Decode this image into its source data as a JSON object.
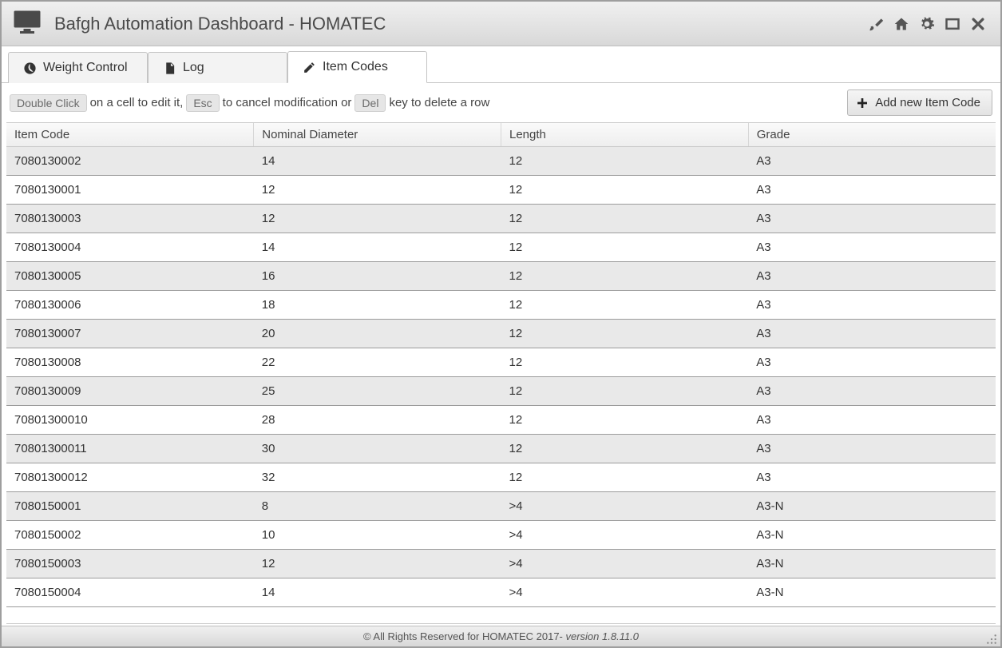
{
  "header": {
    "title": "Bafgh Automation Dashboard - HOMATEC"
  },
  "tabs": [
    {
      "label": "Weight Control",
      "active": false
    },
    {
      "label": "Log",
      "active": false
    },
    {
      "label": "Item Codes",
      "active": true
    }
  ],
  "hint": {
    "kbd_doubleclick": "Double Click",
    "text_oncell": "on a cell to edit it,",
    "kbd_esc": "Esc",
    "text_cancel": "to cancel modification or",
    "kbd_del": "Del",
    "text_delete": "key to delete a row"
  },
  "actions": {
    "add_label": "Add new Item Code"
  },
  "table": {
    "columns": [
      "Item Code",
      "Nominal Diameter",
      "Length",
      "Grade"
    ],
    "rows": [
      {
        "item_code": "7080130002",
        "nominal_diameter": "14",
        "length": "12",
        "grade": "A3"
      },
      {
        "item_code": "7080130001",
        "nominal_diameter": "12",
        "length": "12",
        "grade": "A3"
      },
      {
        "item_code": "7080130003",
        "nominal_diameter": "12",
        "length": "12",
        "grade": "A3"
      },
      {
        "item_code": "7080130004",
        "nominal_diameter": "14",
        "length": "12",
        "grade": "A3"
      },
      {
        "item_code": "7080130005",
        "nominal_diameter": "16",
        "length": "12",
        "grade": "A3"
      },
      {
        "item_code": "7080130006",
        "nominal_diameter": "18",
        "length": "12",
        "grade": "A3"
      },
      {
        "item_code": "7080130007",
        "nominal_diameter": "20",
        "length": "12",
        "grade": "A3"
      },
      {
        "item_code": "7080130008",
        "nominal_diameter": "22",
        "length": "12",
        "grade": "A3"
      },
      {
        "item_code": "7080130009",
        "nominal_diameter": "25",
        "length": "12",
        "grade": "A3"
      },
      {
        "item_code": "70801300010",
        "nominal_diameter": "28",
        "length": "12",
        "grade": "A3"
      },
      {
        "item_code": "70801300011",
        "nominal_diameter": "30",
        "length": "12",
        "grade": "A3"
      },
      {
        "item_code": "70801300012",
        "nominal_diameter": "32",
        "length": "12",
        "grade": "A3"
      },
      {
        "item_code": "7080150001",
        "nominal_diameter": "8",
        "length": ">4",
        "grade": "A3-N"
      },
      {
        "item_code": "7080150002",
        "nominal_diameter": "10",
        "length": ">4",
        "grade": "A3-N"
      },
      {
        "item_code": "7080150003",
        "nominal_diameter": "12",
        "length": ">4",
        "grade": "A3-N"
      },
      {
        "item_code": "7080150004",
        "nominal_diameter": "14",
        "length": ">4",
        "grade": "A3-N"
      }
    ]
  },
  "footer": {
    "copyright": "© All Rights Reserved for HOMATEC 2017-",
    "version": " version 1.8.11.0"
  }
}
